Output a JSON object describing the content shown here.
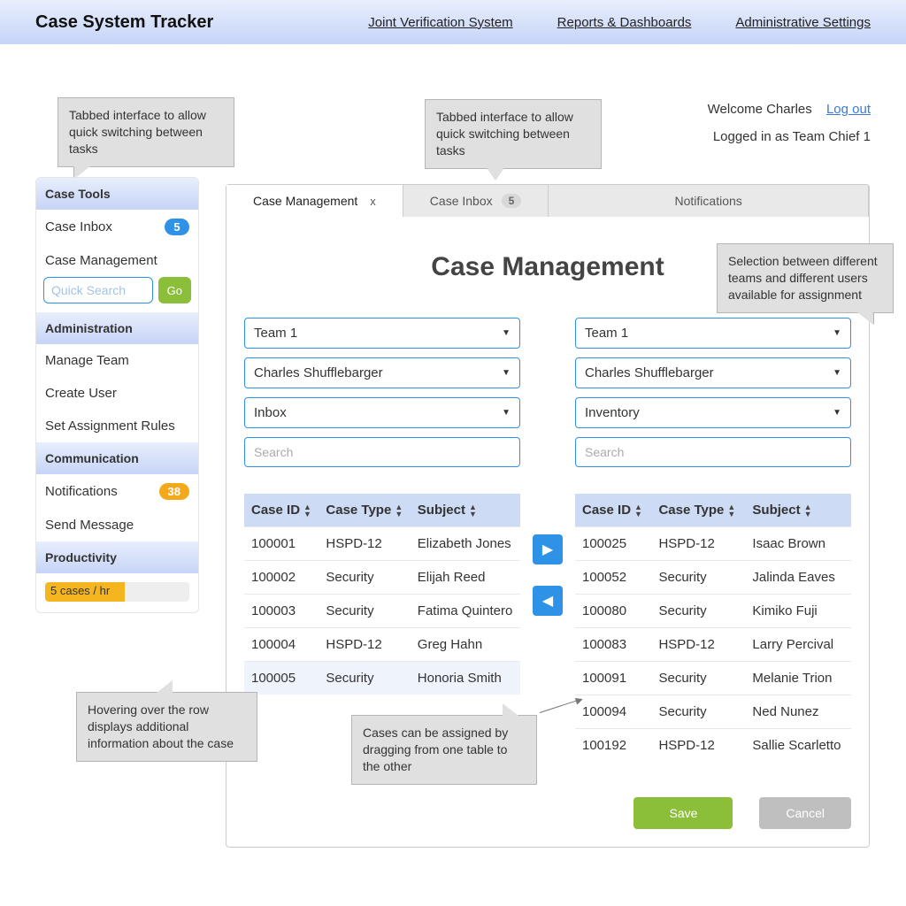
{
  "topbar": {
    "brand": "Case System Tracker",
    "links": [
      "Joint Verification System",
      "Reports & Dashboards",
      "Administrative Settings"
    ]
  },
  "welcome": {
    "greeting": "Welcome Charles",
    "logout": "Log out",
    "role": "Logged in as Team Chief 1"
  },
  "sidebar": {
    "sections": {
      "tools": {
        "title": "Case Tools",
        "items": [
          {
            "label": "Case Inbox",
            "badge": "5"
          },
          {
            "label": "Case Management"
          }
        ],
        "search_placeholder": "Quick Search",
        "go": "Go"
      },
      "admin": {
        "title": "Administration",
        "items": [
          "Manage Team",
          "Create User",
          "Set Assignment Rules"
        ]
      },
      "comm": {
        "title": "Communication",
        "items": [
          {
            "label": "Notifications",
            "badge": "38"
          },
          {
            "label": "Send Message"
          }
        ]
      },
      "prod": {
        "title": "Productivity",
        "rate": "5 cases / hr"
      }
    }
  },
  "tabs": [
    {
      "label": "Case Management",
      "closeable": true
    },
    {
      "label": "Case Inbox",
      "badge": "5"
    },
    {
      "label": "Notifications"
    }
  ],
  "page_title": "Case Management",
  "panes": {
    "left": {
      "team": "Team 1",
      "user": "Charles Shufflebarger",
      "bucket": "Inbox",
      "search_placeholder": "Search",
      "columns": [
        "Case ID",
        "Case Type",
        "Subject"
      ],
      "rows": [
        {
          "id": "100001",
          "type": "HSPD-12",
          "subject": "Elizabeth Jones"
        },
        {
          "id": "100002",
          "type": "Security",
          "subject": "Elijah Reed"
        },
        {
          "id": "100003",
          "type": "Security",
          "subject": "Fatima Quintero"
        },
        {
          "id": "100004",
          "type": "HSPD-12",
          "subject": "Greg Hahn"
        },
        {
          "id": "100005",
          "type": "Security",
          "subject": "Honoria Smith"
        }
      ],
      "hover_row": 4
    },
    "right": {
      "team": "Team 1",
      "user": "Charles Shufflebarger",
      "bucket": "Inventory",
      "search_placeholder": "Search",
      "columns": [
        "Case ID",
        "Case Type",
        "Subject"
      ],
      "rows": [
        {
          "id": "100025",
          "type": "HSPD-12",
          "subject": "Isaac Brown"
        },
        {
          "id": "100052",
          "type": "Security",
          "subject": "Jalinda Eaves"
        },
        {
          "id": "100080",
          "type": "Security",
          "subject": "Kimiko Fuji"
        },
        {
          "id": "100083",
          "type": "HSPD-12",
          "subject": "Larry Percival"
        },
        {
          "id": "100091",
          "type": "Security",
          "subject": "Melanie Trion"
        },
        {
          "id": "100094",
          "type": "Security",
          "subject": "Ned Nunez"
        },
        {
          "id": "100192",
          "type": "HSPD-12",
          "subject": "Sallie Scarletto"
        }
      ]
    }
  },
  "actions": {
    "save": "Save",
    "cancel": "Cancel"
  },
  "callouts": {
    "tabs1": "Tabbed interface to allow quick switching between tasks",
    "tabs2": "Tabbed interface to allow quick switching between tasks",
    "teamsel": "Selection between different teams and different users available for assignment",
    "hover": "Hovering over the row displays additional information about the case",
    "drag": "Cases can be assigned by dragging from one table to the other"
  }
}
